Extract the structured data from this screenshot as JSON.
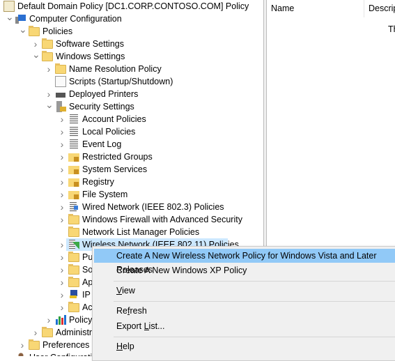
{
  "tree": [
    {
      "label": "Default Domain Policy [DC1.CORP.CONTOSO.COM] Policy",
      "depth": 0,
      "state": "none",
      "icon": "policy-scroll-icon"
    },
    {
      "label": "Computer Configuration",
      "depth": 1,
      "state": "open",
      "icon": "computer-icon"
    },
    {
      "label": "Policies",
      "depth": 2,
      "state": "open",
      "icon": "folder-icon"
    },
    {
      "label": "Software Settings",
      "depth": 3,
      "state": "closed",
      "icon": "folder-icon"
    },
    {
      "label": "Windows Settings",
      "depth": 3,
      "state": "open",
      "icon": "folder-icon"
    },
    {
      "label": "Name Resolution Policy",
      "depth": 4,
      "state": "closed",
      "icon": "folder-icon"
    },
    {
      "label": "Scripts (Startup/Shutdown)",
      "depth": 4,
      "state": "none",
      "icon": "script-icon"
    },
    {
      "label": "Deployed Printers",
      "depth": 4,
      "state": "closed",
      "icon": "printer-icon"
    },
    {
      "label": "Security Settings",
      "depth": 4,
      "state": "open",
      "icon": "security-lock-icon"
    },
    {
      "label": "Account Policies",
      "depth": 5,
      "state": "closed",
      "icon": "policy-list-icon"
    },
    {
      "label": "Local Policies",
      "depth": 5,
      "state": "closed",
      "icon": "policy-list-icon"
    },
    {
      "label": "Event Log",
      "depth": 5,
      "state": "closed",
      "icon": "policy-list-icon"
    },
    {
      "label": "Restricted Groups",
      "depth": 5,
      "state": "closed",
      "icon": "locked-folder-icon"
    },
    {
      "label": "System Services",
      "depth": 5,
      "state": "closed",
      "icon": "locked-folder-icon"
    },
    {
      "label": "Registry",
      "depth": 5,
      "state": "closed",
      "icon": "locked-folder-icon"
    },
    {
      "label": "File System",
      "depth": 5,
      "state": "closed",
      "icon": "locked-folder-icon"
    },
    {
      "label": "Wired Network (IEEE 802.3) Policies",
      "depth": 5,
      "state": "closed",
      "icon": "wired-network-icon"
    },
    {
      "label": "Windows Firewall with Advanced Security",
      "depth": 5,
      "state": "closed",
      "icon": "folder-icon"
    },
    {
      "label": "Network List Manager Policies",
      "depth": 5,
      "state": "none",
      "icon": "folder-icon"
    },
    {
      "label": "Wireless Network (IEEE 802.11) Policies",
      "depth": 5,
      "state": "closed",
      "icon": "wireless-network-icon",
      "selected": true
    },
    {
      "label": "Pu",
      "depth": 5,
      "state": "closed",
      "icon": "folder-icon"
    },
    {
      "label": "So",
      "depth": 5,
      "state": "closed",
      "icon": "folder-icon"
    },
    {
      "label": "Ap",
      "depth": 5,
      "state": "closed",
      "icon": "folder-icon"
    },
    {
      "label": "IP",
      "depth": 5,
      "state": "closed",
      "icon": "ip-security-icon"
    },
    {
      "label": "Ac",
      "depth": 5,
      "state": "closed",
      "icon": "folder-icon"
    },
    {
      "label": "Policy",
      "depth": 4,
      "state": "closed",
      "icon": "bar-chart-icon"
    },
    {
      "label": "Administr",
      "depth": 3,
      "state": "closed",
      "icon": "folder-icon"
    },
    {
      "label": "Preferences",
      "depth": 2,
      "state": "closed",
      "icon": "folder-icon"
    },
    {
      "label": "User Configuration",
      "depth": 1,
      "state": "closed",
      "icon": "user-icon"
    }
  ],
  "list": {
    "columns": [
      "Name",
      "Descrip"
    ],
    "partial_text": "Th"
  },
  "menu": {
    "items": [
      {
        "label": "Create A New Wireless Network Policy for Windows Vista and Later Releases",
        "highlighted": true
      },
      {
        "label": "Create A New Windows XP Policy"
      },
      {
        "separator": true
      },
      {
        "label": "View",
        "accel": "V"
      },
      {
        "separator": true
      },
      {
        "label": "Refresh",
        "accel": "f"
      },
      {
        "label": "Export List...",
        "accel": "L"
      },
      {
        "separator": true
      },
      {
        "label": "Help",
        "accel": "H"
      }
    ]
  },
  "colors": {
    "selection": "#cce8ff",
    "menu_highlight": "#91c9f7",
    "menu_bg": "#f0f0f0"
  }
}
